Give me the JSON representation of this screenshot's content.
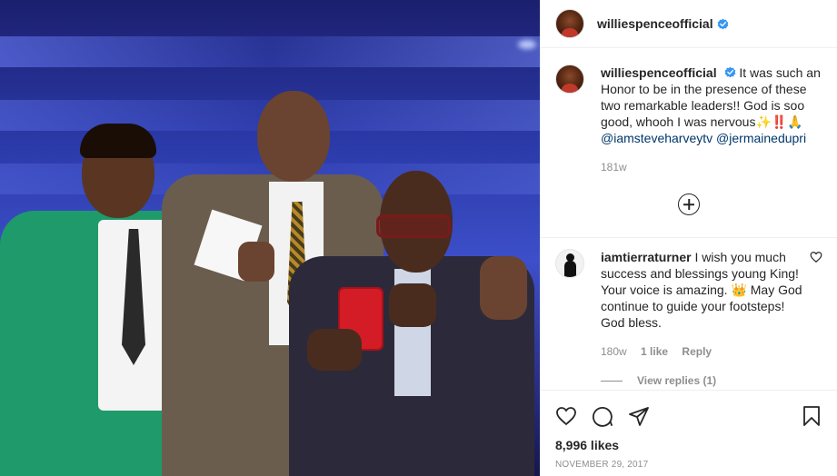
{
  "post": {
    "username": "williespenceofficial",
    "verified": true
  },
  "caption": {
    "username": "williespenceofficial",
    "text": "It was such an Honor to be in the presence of these two remarkable leaders!! God is soo good, whooh I was nervous✨‼️🙏",
    "mentions": [
      "@iamsteveharveytv",
      "@jermainedupri"
    ],
    "time": "181w"
  },
  "comments": [
    {
      "username": "iamtierraturner",
      "text": "I wish you much success and blessings young King! Your voice is amazing. 👑 May God continue to guide your footsteps! God bless.",
      "time": "180w",
      "likes": "1 like",
      "reply_label": "Reply",
      "view_replies": "View replies (1)"
    }
  ],
  "actions": {
    "icons": [
      "heart-icon",
      "comment-icon",
      "share-icon",
      "bookmark-icon"
    ]
  },
  "likes": "8,996 likes",
  "date": "NOVEMBER 29, 2017",
  "colors": {
    "verified_blue": "#3897f0",
    "link_blue": "#00376b",
    "muted_gray": "#8e8e8e",
    "green_jacket": "#1f9a6a"
  }
}
